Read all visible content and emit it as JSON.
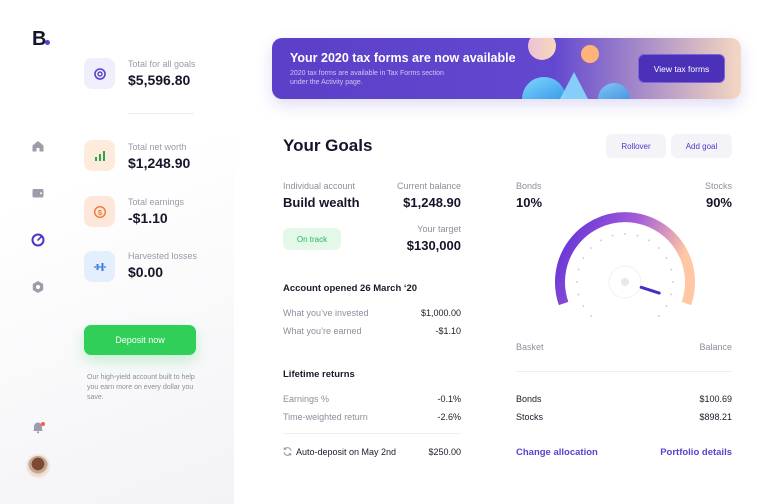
{
  "app": {
    "logo": "B"
  },
  "rail": {
    "icons": [
      "home-icon",
      "wallet-icon",
      "dashboard-icon",
      "settings-icon",
      "bell-icon"
    ],
    "accent": "#5a3fd1"
  },
  "stats": [
    {
      "label": "Total for all goals",
      "value": "$5,596.80",
      "icon": "target-icon",
      "bg": "#efeefb"
    },
    {
      "label": "Total net worth",
      "value": "$1,248.90",
      "icon": "bar-chart-icon",
      "bg": "#fdebdc"
    },
    {
      "label": "Total earnings",
      "value": "-$1.10",
      "icon": "dollar-icon",
      "bg": "#fde6da"
    },
    {
      "label": "Harvested losses",
      "value": "$0.00",
      "icon": "chart-candles-icon",
      "bg": "#e3effd"
    }
  ],
  "deposit": {
    "label": "Deposit now"
  },
  "promo": "Our high-yield account built to help you earn more on every dollar you save.",
  "banner": {
    "title": "Your 2020 tax forms are now available",
    "subtitle": "2020 tax forms are available in Tax Forms section under the Activity page.",
    "button": "View tax forms"
  },
  "goals": {
    "title": "Your Goals",
    "rollover": "Rollover",
    "add_goal": "Add goal",
    "account_label": "Individual account",
    "account_name": "Build wealth",
    "balance_label": "Current balance",
    "balance_value": "$1,248.90",
    "status": "On track",
    "target_label": "Your target",
    "target_value": "$130,000",
    "opened": "Account opened 26 March ‘20",
    "invested_label": "What you’ve invested",
    "invested_value": "$1,000.00",
    "earned_label": "What you’re earned",
    "earned_value": "-$1.10",
    "lifetime_title": "Lifetime returns",
    "earnings_label": "Earnings %",
    "earnings_value": "-0.1%",
    "tw_label": "Time-weighted return",
    "tw_value": "-2.6%",
    "autodeposit_label": "Auto-deposit on May 2nd",
    "autodeposit_value": "$250.00"
  },
  "allocation": {
    "bonds_label": "Bonds",
    "bonds_pct": "10%",
    "stocks_label": "Stocks",
    "stocks_pct": "90%",
    "needle_fraction": 0.9,
    "basket_label": "Basket",
    "balance_label": "Balance",
    "bonds_row_label": "Bonds",
    "bonds_row_value": "$100.69",
    "stocks_row_label": "Stocks",
    "stocks_row_value": "$898.21",
    "change_link": "Change allocation",
    "portfolio_link": "Portfolio details"
  }
}
